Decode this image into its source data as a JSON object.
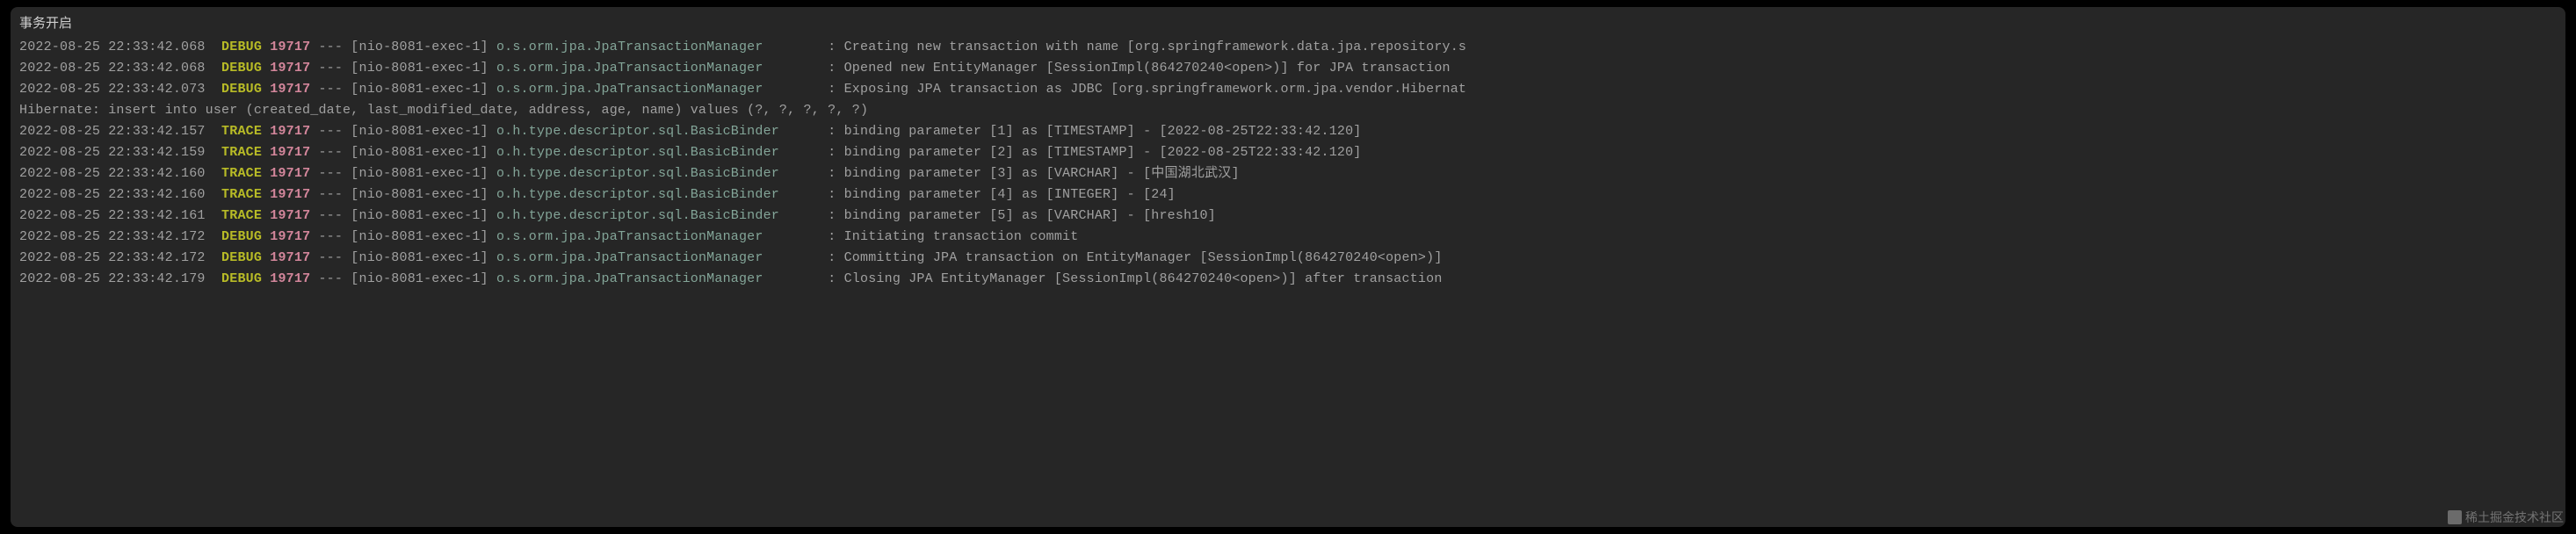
{
  "header": "事务开启",
  "pid": "19717",
  "separator": "---",
  "thread": "[nio-8081-exec-1]",
  "colon": ":",
  "watermark": "稀土掘金技术社区",
  "lines": [
    {
      "ts": "2022-08-25 22:33:42.068",
      "level": "DEBUG",
      "logger": "o.s.orm.jpa.JpaTransactionManager      ",
      "msg": "Creating new transaction with name [org.springframework.data.jpa.repository.s"
    },
    {
      "ts": "2022-08-25 22:33:42.068",
      "level": "DEBUG",
      "logger": "o.s.orm.jpa.JpaTransactionManager      ",
      "msg": "Opened new EntityManager [SessionImpl(864270240<open>)] for JPA transaction"
    },
    {
      "ts": "2022-08-25 22:33:42.073",
      "level": "DEBUG",
      "logger": "o.s.orm.jpa.JpaTransactionManager      ",
      "msg": "Exposing JPA transaction as JDBC [org.springframework.orm.jpa.vendor.Hibernat"
    }
  ],
  "sql": "Hibernate: insert into user (created_date, last_modified_date, address, age, name) values (?, ?, ?, ?, ?)",
  "lines2": [
    {
      "ts": "2022-08-25 22:33:42.157",
      "level": "TRACE",
      "logger": "o.h.type.descriptor.sql.BasicBinder    ",
      "msg": "binding parameter [1] as [TIMESTAMP] - [2022-08-25T22:33:42.120]"
    },
    {
      "ts": "2022-08-25 22:33:42.159",
      "level": "TRACE",
      "logger": "o.h.type.descriptor.sql.BasicBinder    ",
      "msg": "binding parameter [2] as [TIMESTAMP] - [2022-08-25T22:33:42.120]"
    },
    {
      "ts": "2022-08-25 22:33:42.160",
      "level": "TRACE",
      "logger": "o.h.type.descriptor.sql.BasicBinder    ",
      "msg": "binding parameter [3] as [VARCHAR] - [中国湖北武汉]"
    },
    {
      "ts": "2022-08-25 22:33:42.160",
      "level": "TRACE",
      "logger": "o.h.type.descriptor.sql.BasicBinder    ",
      "msg": "binding parameter [4] as [INTEGER] - [24]"
    },
    {
      "ts": "2022-08-25 22:33:42.161",
      "level": "TRACE",
      "logger": "o.h.type.descriptor.sql.BasicBinder    ",
      "msg": "binding parameter [5] as [VARCHAR] - [hresh10]"
    },
    {
      "ts": "2022-08-25 22:33:42.172",
      "level": "DEBUG",
      "logger": "o.s.orm.jpa.JpaTransactionManager      ",
      "msg": "Initiating transaction commit"
    },
    {
      "ts": "2022-08-25 22:33:42.172",
      "level": "DEBUG",
      "logger": "o.s.orm.jpa.JpaTransactionManager      ",
      "msg": "Committing JPA transaction on EntityManager [SessionImpl(864270240<open>)]"
    },
    {
      "ts": "2022-08-25 22:33:42.179",
      "level": "DEBUG",
      "logger": "o.s.orm.jpa.JpaTransactionManager      ",
      "msg": "Closing JPA EntityManager [SessionImpl(864270240<open>)] after transaction"
    }
  ]
}
